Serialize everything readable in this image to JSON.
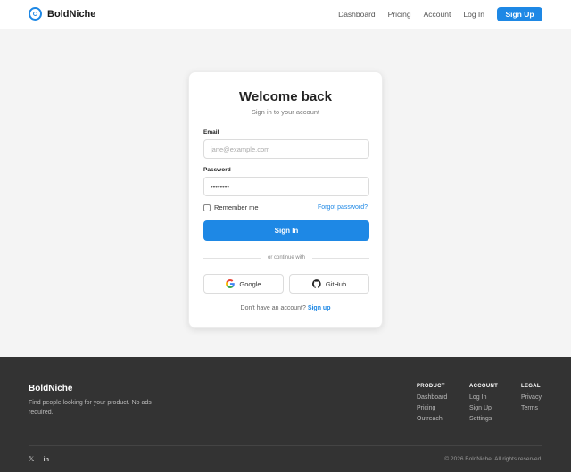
{
  "header": {
    "brand": "BoldNiche",
    "nav": [
      "Dashboard",
      "Pricing",
      "Account",
      "Log In"
    ],
    "signup": "Sign Up"
  },
  "card": {
    "title": "Welcome back",
    "subtitle": "Sign in to your account",
    "email_label": "Email",
    "email_placeholder": "jane@example.com",
    "password_label": "Password",
    "password_value": "••••••••",
    "remember": "Remember me",
    "forgot": "Forgot password?",
    "signin": "Sign In",
    "divider": "or continue with",
    "google": "Google",
    "github": "GitHub",
    "account_prompt": "Don't have an account?",
    "account_link": "Sign up"
  },
  "footer": {
    "brand": "BoldNiche",
    "description": "Find people looking for your product. No ads required.",
    "columns": [
      {
        "title": "PRODUCT",
        "links": [
          "Dashboard",
          "Pricing",
          "Outreach"
        ]
      },
      {
        "title": "ACCOUNT",
        "links": [
          "Log In",
          "Sign Up",
          "Settings"
        ]
      },
      {
        "title": "LEGAL",
        "links": [
          "Privacy",
          "Terms"
        ]
      }
    ],
    "socials": [
      "x-icon",
      "linkedin-icon"
    ],
    "copyright": "© 2026 BoldNiche. All rights reserved."
  },
  "colors": {
    "accent": "#1e88e5",
    "footer_bg": "#333333",
    "page_bg": "#f4f4f4"
  }
}
